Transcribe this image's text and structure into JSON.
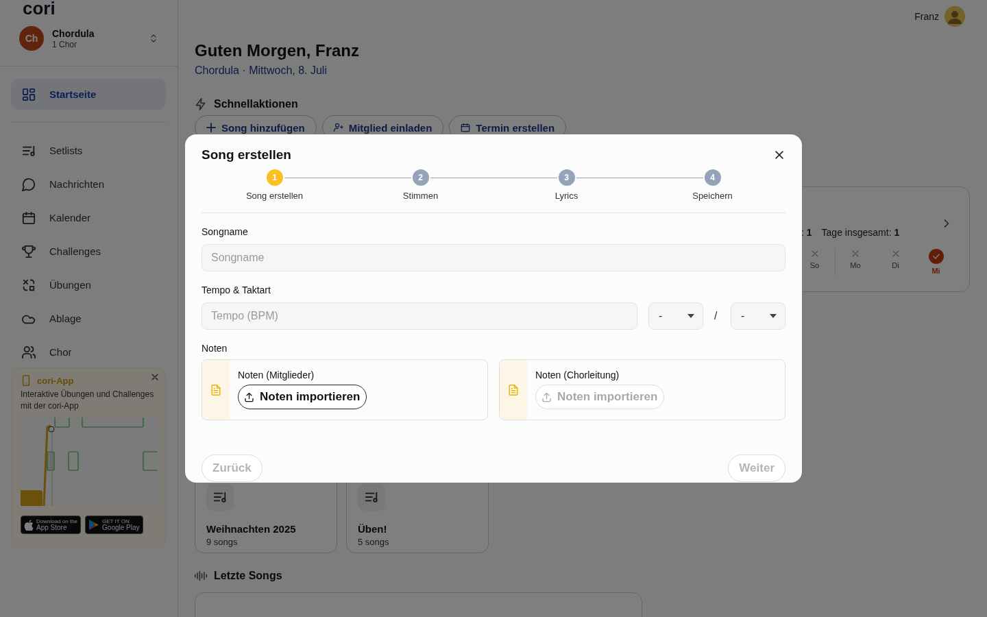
{
  "app": {
    "logo": "cori"
  },
  "user": {
    "name": "Franz"
  },
  "choir_switcher": {
    "initials": "Ch",
    "name": "Chordula",
    "subtitle": "1 Chor"
  },
  "sidebar": {
    "primary": [
      {
        "label": "Startseite",
        "selected": true
      }
    ],
    "items": [
      {
        "label": "Setlists",
        "selected": false
      },
      {
        "label": "Nachrichten",
        "selected": false
      },
      {
        "label": "Kalender",
        "selected": false
      },
      {
        "label": "Challenges",
        "selected": false
      },
      {
        "label": "Übungen",
        "selected": false
      },
      {
        "label": "Ablage",
        "selected": false
      },
      {
        "label": "Chor",
        "selected": false
      }
    ]
  },
  "promo": {
    "title": "cori-App",
    "text": "Interaktive Übungen und Challenges mit der cori-App",
    "badges": [
      {
        "kind": "apple",
        "small": "Download on the",
        "big": "App Store"
      },
      {
        "kind": "google",
        "small": "GET IT ON",
        "big": "Google Play"
      }
    ]
  },
  "greeting": {
    "title": "Guten Morgen, Franz",
    "subtitle": "Chordula · Mittwoch, 8. Juli"
  },
  "quick_actions": {
    "title": "Schnellaktionen",
    "buttons": [
      {
        "label": "Song hinzufügen"
      },
      {
        "label": "Mitglied einladen"
      },
      {
        "label": "Termin erstellen"
      }
    ]
  },
  "streak": {
    "stats": [
      ": **1**",
      "Tage insgesamt: **1**"
    ],
    "days": [
      {
        "label": "So",
        "done": false
      },
      {
        "label": "Mo",
        "done": false
      },
      {
        "label": "Di",
        "done": false
      },
      {
        "label": "Mi",
        "done": true
      }
    ]
  },
  "setlists": [
    {
      "name": "Weihnachten 2025",
      "count": "9 songs"
    },
    {
      "name": "Üben!",
      "count": "5 songs"
    }
  ],
  "recent_songs": {
    "title": "Letzte Songs"
  },
  "dialog": {
    "title": "Song erstellen",
    "steps": [
      {
        "number": "1",
        "label": "Song erstellen",
        "selected": true
      },
      {
        "number": "2",
        "label": "Stimmen",
        "selected": false
      },
      {
        "number": "3",
        "label": "Lyrics",
        "selected": false
      },
      {
        "number": "4",
        "label": "Speichern",
        "selected": false
      }
    ],
    "songname": {
      "label": "Songname",
      "placeholder": "Songname"
    },
    "tempo": {
      "label": "Tempo & Taktart",
      "placeholder": "Tempo (BPM)",
      "beats": "-",
      "separator": "/",
      "unit": "-"
    },
    "notes_label": "Noten",
    "uploads": [
      {
        "title": "Noten (Mitglieder)",
        "button": "Noten importieren",
        "disabled": false
      },
      {
        "title": "Noten (Chorleitung)",
        "button": "Noten importieren",
        "disabled": true
      }
    ],
    "back": {
      "label": "Zurück",
      "disabled": true
    },
    "next": {
      "label": "Weiter",
      "disabled": true
    }
  }
}
